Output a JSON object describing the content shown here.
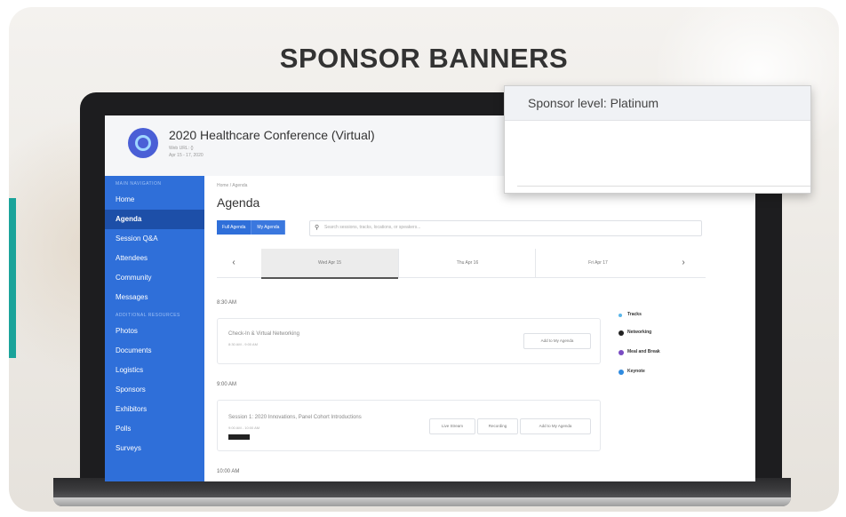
{
  "heading": "SPONSOR BANNERS",
  "app": {
    "title": "2020 Healthcare Conference (Virtual)",
    "subtitle_line1": "Web URL: {}",
    "subtitle_line2": "Apr 15 - 17, 2020"
  },
  "sidebar": {
    "section1": "MAIN NAVIGATION",
    "items1": [
      "Home",
      "Agenda",
      "Session Q&A",
      "Attendees",
      "Community",
      "Messages"
    ],
    "section2": "ADDITIONAL RESOURCES",
    "items2": [
      "Photos",
      "Documents",
      "Logistics",
      "Sponsors",
      "Exhibitors",
      "Polls",
      "Surveys"
    ],
    "active": "Agenda"
  },
  "main": {
    "breadcrumb": "Home / Agenda",
    "page_title": "Agenda",
    "full_agenda_label": "Full Agenda",
    "my_agenda_label": "My Agenda",
    "search_placeholder": "Search sessions, tracks, locations, or speakers...",
    "day_tabs": [
      "Wed Apr 15",
      "Thu Apr 16",
      "Fri Apr 17"
    ],
    "prev_arrow": "‹",
    "next_arrow": "›",
    "times": [
      "8:30 AM",
      "9:00 AM",
      "10:00 AM"
    ],
    "session1": {
      "title": "Check-In & Virtual Networking",
      "time": "8:30 AM - 9:00 AM",
      "add_label": "Add to My Agenda"
    },
    "session2": {
      "title": "Session 1: 2020 Innovations, Panel Cohort Introductions",
      "time": "9:00 AM - 10:00 AM",
      "live_label": "Live Stream",
      "recording_label": "Recording",
      "add_label": "Add to My Agenda"
    }
  },
  "legend": [
    {
      "label": "Tracks",
      "color": "#5bb6e8"
    },
    {
      "label": "Networking",
      "color": "#222222"
    },
    {
      "label": "Meal and Break",
      "color": "#7a4cc2"
    },
    {
      "label": "Keynote",
      "color": "#2f8be0"
    }
  ],
  "popup": {
    "title": "Sponsor level: Platinum"
  },
  "colors": {
    "accent": "#2f6fd9",
    "sidebar_active": "#1d4fa8",
    "teal": "#1aa39a"
  }
}
